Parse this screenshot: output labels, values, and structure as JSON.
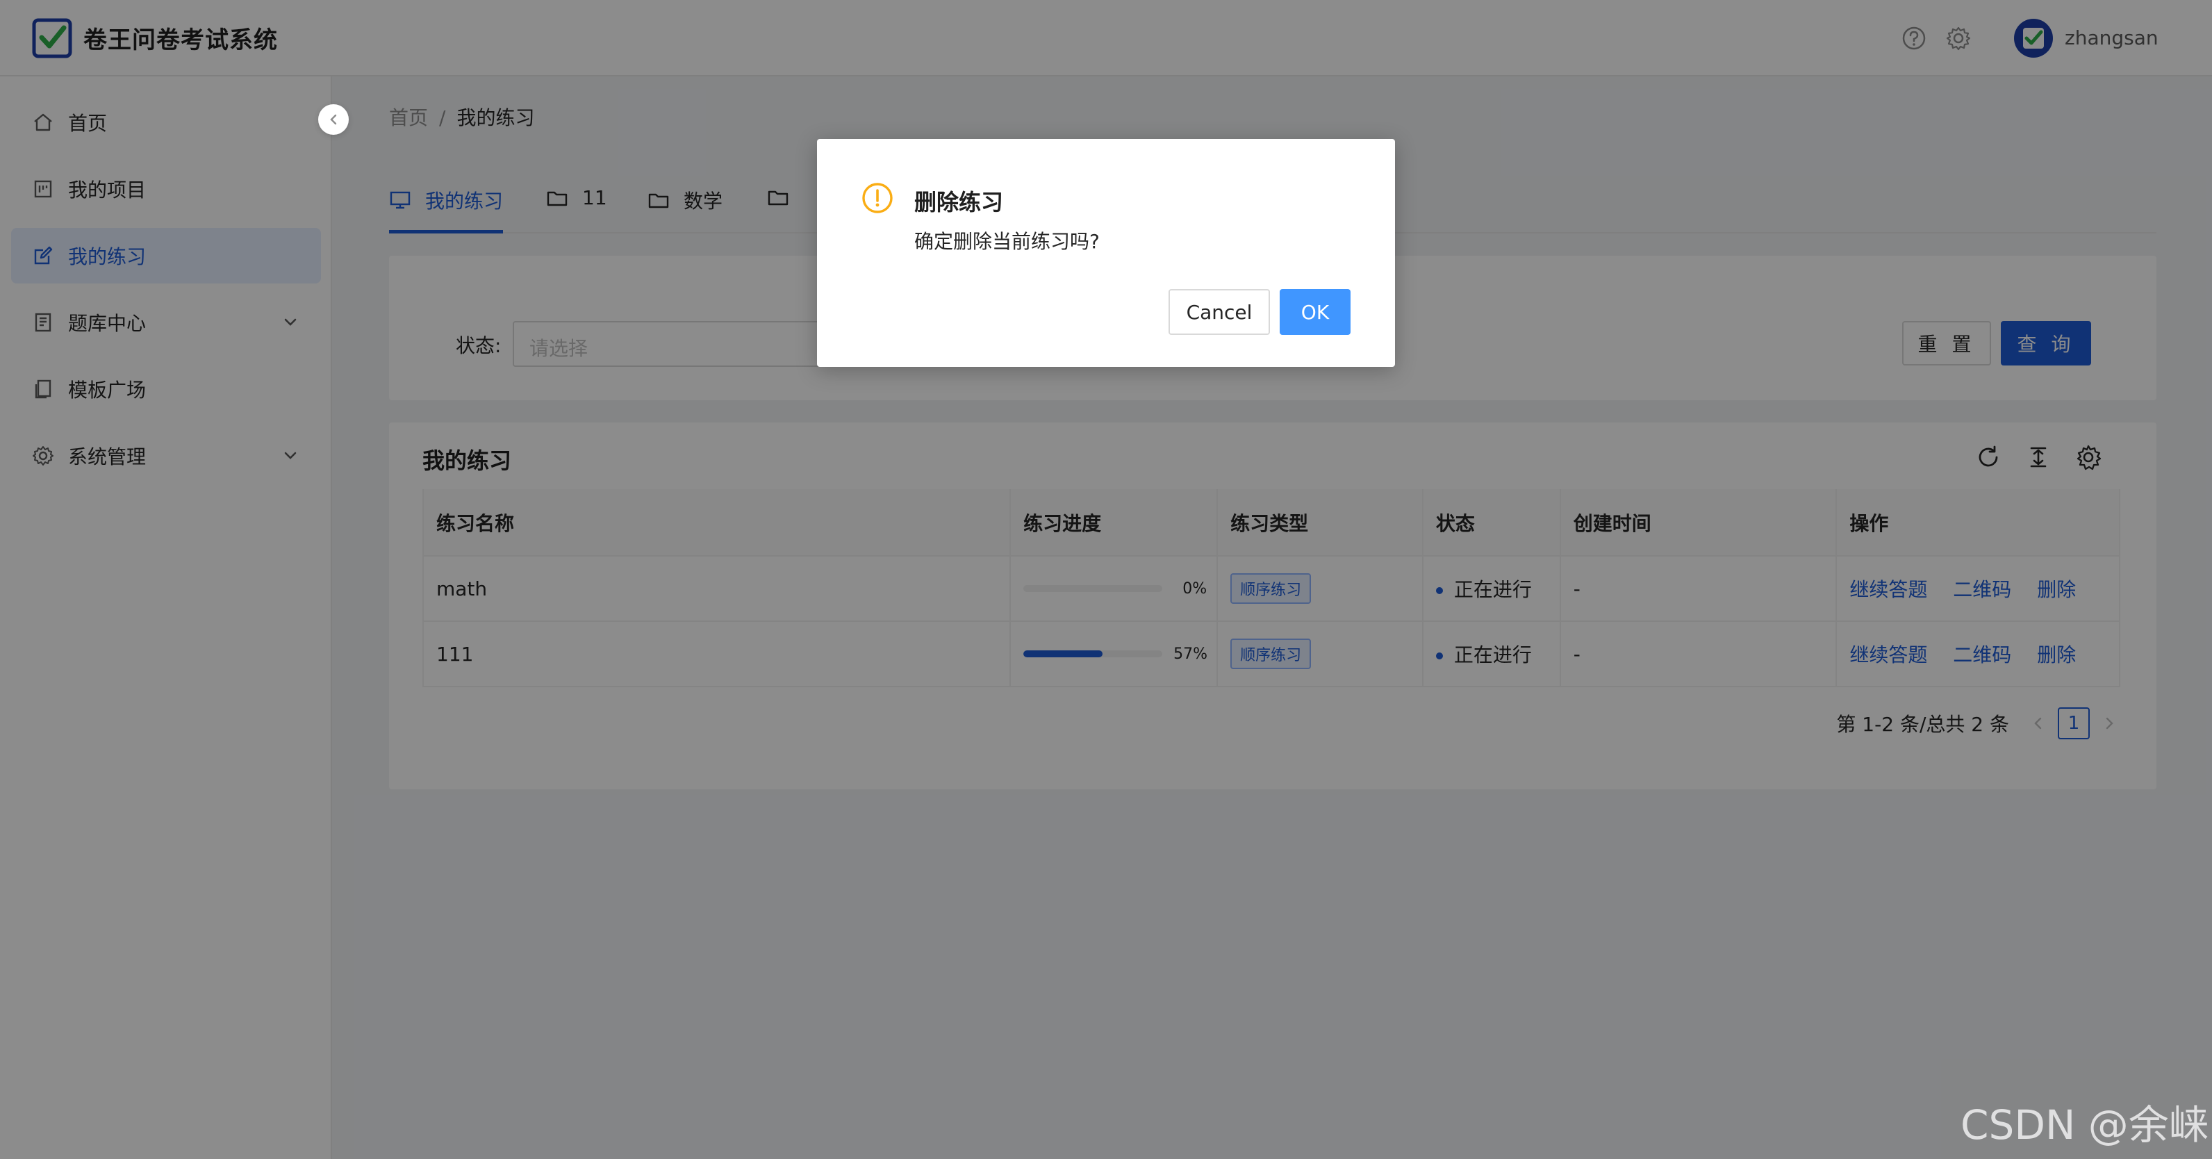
{
  "header": {
    "app_title": "卷王问卷考试系统",
    "username": "zhangsan"
  },
  "sidebar": {
    "items": [
      {
        "label": "首页",
        "icon": "home-icon"
      },
      {
        "label": "我的项目",
        "icon": "project-icon"
      },
      {
        "label": "我的练习",
        "icon": "edit-icon",
        "active": true
      },
      {
        "label": "题库中心",
        "icon": "book-icon",
        "expandable": true
      },
      {
        "label": "模板广场",
        "icon": "template-icon"
      },
      {
        "label": "系统管理",
        "icon": "gear-icon",
        "expandable": true
      }
    ]
  },
  "breadcrumb": {
    "home": "首页",
    "separator": "/",
    "current": "我的练习"
  },
  "tabs": [
    {
      "label": "我的练习",
      "icon": "monitor-icon",
      "active": true
    },
    {
      "label": "11",
      "icon": "folder-icon"
    },
    {
      "label": "数学",
      "icon": "folder-icon"
    },
    {
      "label": "",
      "icon": "folder-icon"
    }
  ],
  "search": {
    "status_label": "状态:",
    "status_placeholder": "请选择",
    "reset_label": "重 置",
    "query_label": "查 询"
  },
  "table": {
    "title": "我的练习",
    "columns": [
      "练习名称",
      "练习进度",
      "练习类型",
      "状态",
      "创建时间",
      "操作"
    ],
    "rows": [
      {
        "name": "math",
        "progress": 0,
        "progress_text": "0%",
        "type": "顺序练习",
        "status": "正在进行",
        "created": "-",
        "actions": [
          "继续答题",
          "二维码",
          "删除"
        ]
      },
      {
        "name": "111",
        "progress": 57,
        "progress_text": "57%",
        "type": "顺序练习",
        "status": "正在进行",
        "created": "-",
        "actions": [
          "继续答题",
          "二维码",
          "删除"
        ]
      }
    ]
  },
  "pagination": {
    "summary": "第 1-2 条/总共 2 条",
    "current_page": "1"
  },
  "modal": {
    "title": "删除练习",
    "content": "确定删除当前练习吗?",
    "cancel_label": "Cancel",
    "ok_label": "OK"
  },
  "watermark": "CSDN @余崃",
  "colors": {
    "primary": "#1e5bd6",
    "ok_button": "#4096ff",
    "warning": "#faad14"
  }
}
